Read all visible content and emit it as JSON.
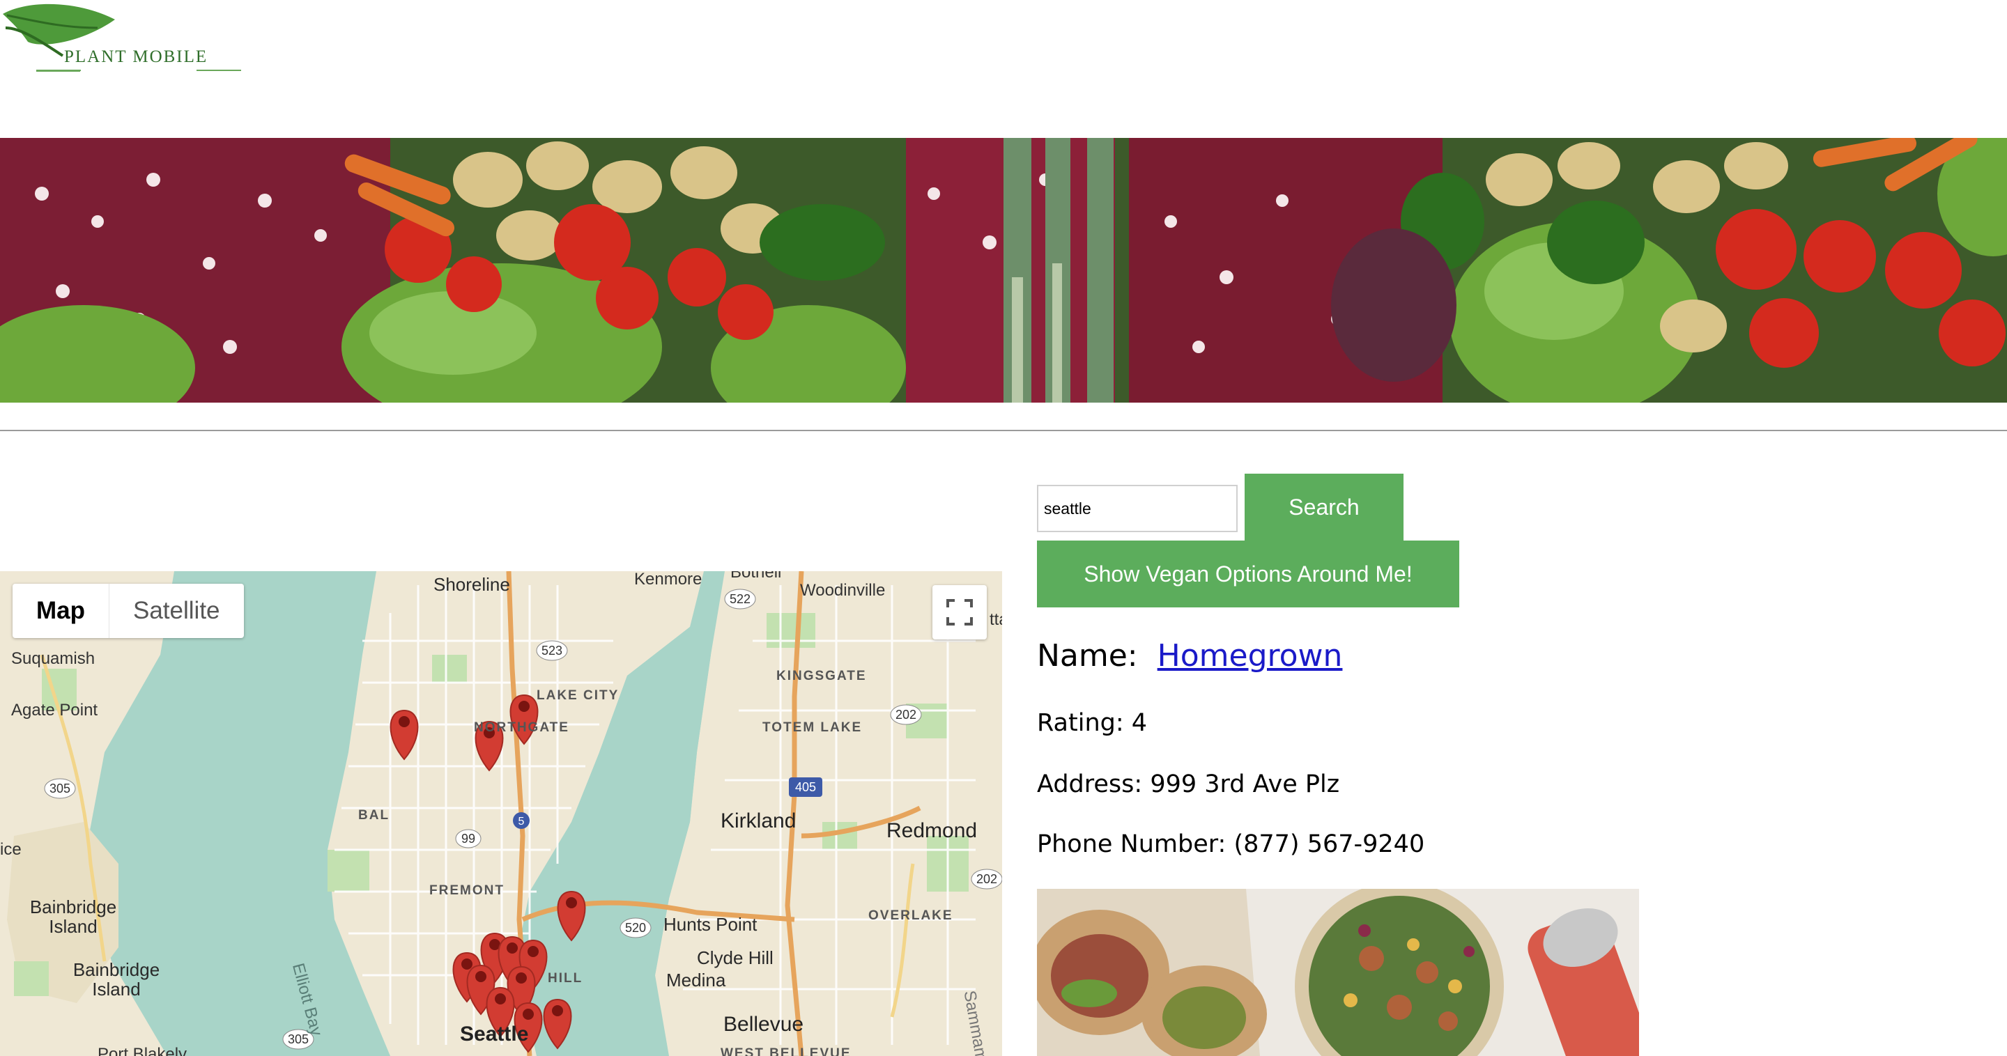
{
  "brand": {
    "name": "PLANT MOBILE"
  },
  "map": {
    "type_controls": [
      {
        "label": "Map",
        "active": true
      },
      {
        "label": "Satellite",
        "active": false
      }
    ],
    "places": {
      "shoreline": "Shoreline",
      "kenmore": "Kenmore",
      "bothell": "Bothell",
      "woodinville": "Woodinville",
      "suquamish": "Suquamish",
      "agate_point": "Agate Point",
      "lake_city": "LAKE CITY",
      "northgate": "NORTHGATE",
      "kingsgate": "KINGSGATE",
      "totem_lake": "TOTEM LAKE",
      "ballard": "BAL",
      "fremont": "FREMONT",
      "kirkland": "Kirkland",
      "redmond": "Redmond",
      "overlake": "OVERLAKE",
      "hunts_point": "Hunts Point",
      "clyde_hill": "Clyde Hill",
      "medina": "Medina",
      "bellevue": "Bellevue",
      "west_bellevue": "WEST BELLEVUE",
      "bainbridge_island": "Bainbridge Island",
      "bainbridge_island_2": "Bainbridge Island",
      "seattle": "Seattle",
      "elliott_bay": "Elliott Bay",
      "port_blakely": "Port Blakely",
      "ice": "ice",
      "capitol_hill": "HILL",
      "tta": "tta",
      "sammamish": "Sammamish"
    },
    "route_shields": [
      "522",
      "523",
      "202",
      "305",
      "405",
      "99",
      "520",
      "202",
      "305",
      "5"
    ]
  },
  "search": {
    "value": "seattle",
    "button_label": "Search",
    "vegan_button_label": "Show Vegan Options Around Me!"
  },
  "restaurant": {
    "name_label": "Name:",
    "name": "Homegrown",
    "rating_label": "Rating:",
    "rating": "4",
    "address_label": "Address:",
    "address": "999 3rd Ave  Plz",
    "phone_label": "Phone  Number:",
    "phone": "(877) 567-9240"
  },
  "colors": {
    "button_green": "#5cad5c",
    "link_blue": "#1a1ac8",
    "marker_red": "#d23c32",
    "water": "#a8d4c8",
    "land": "#efe8d5"
  }
}
